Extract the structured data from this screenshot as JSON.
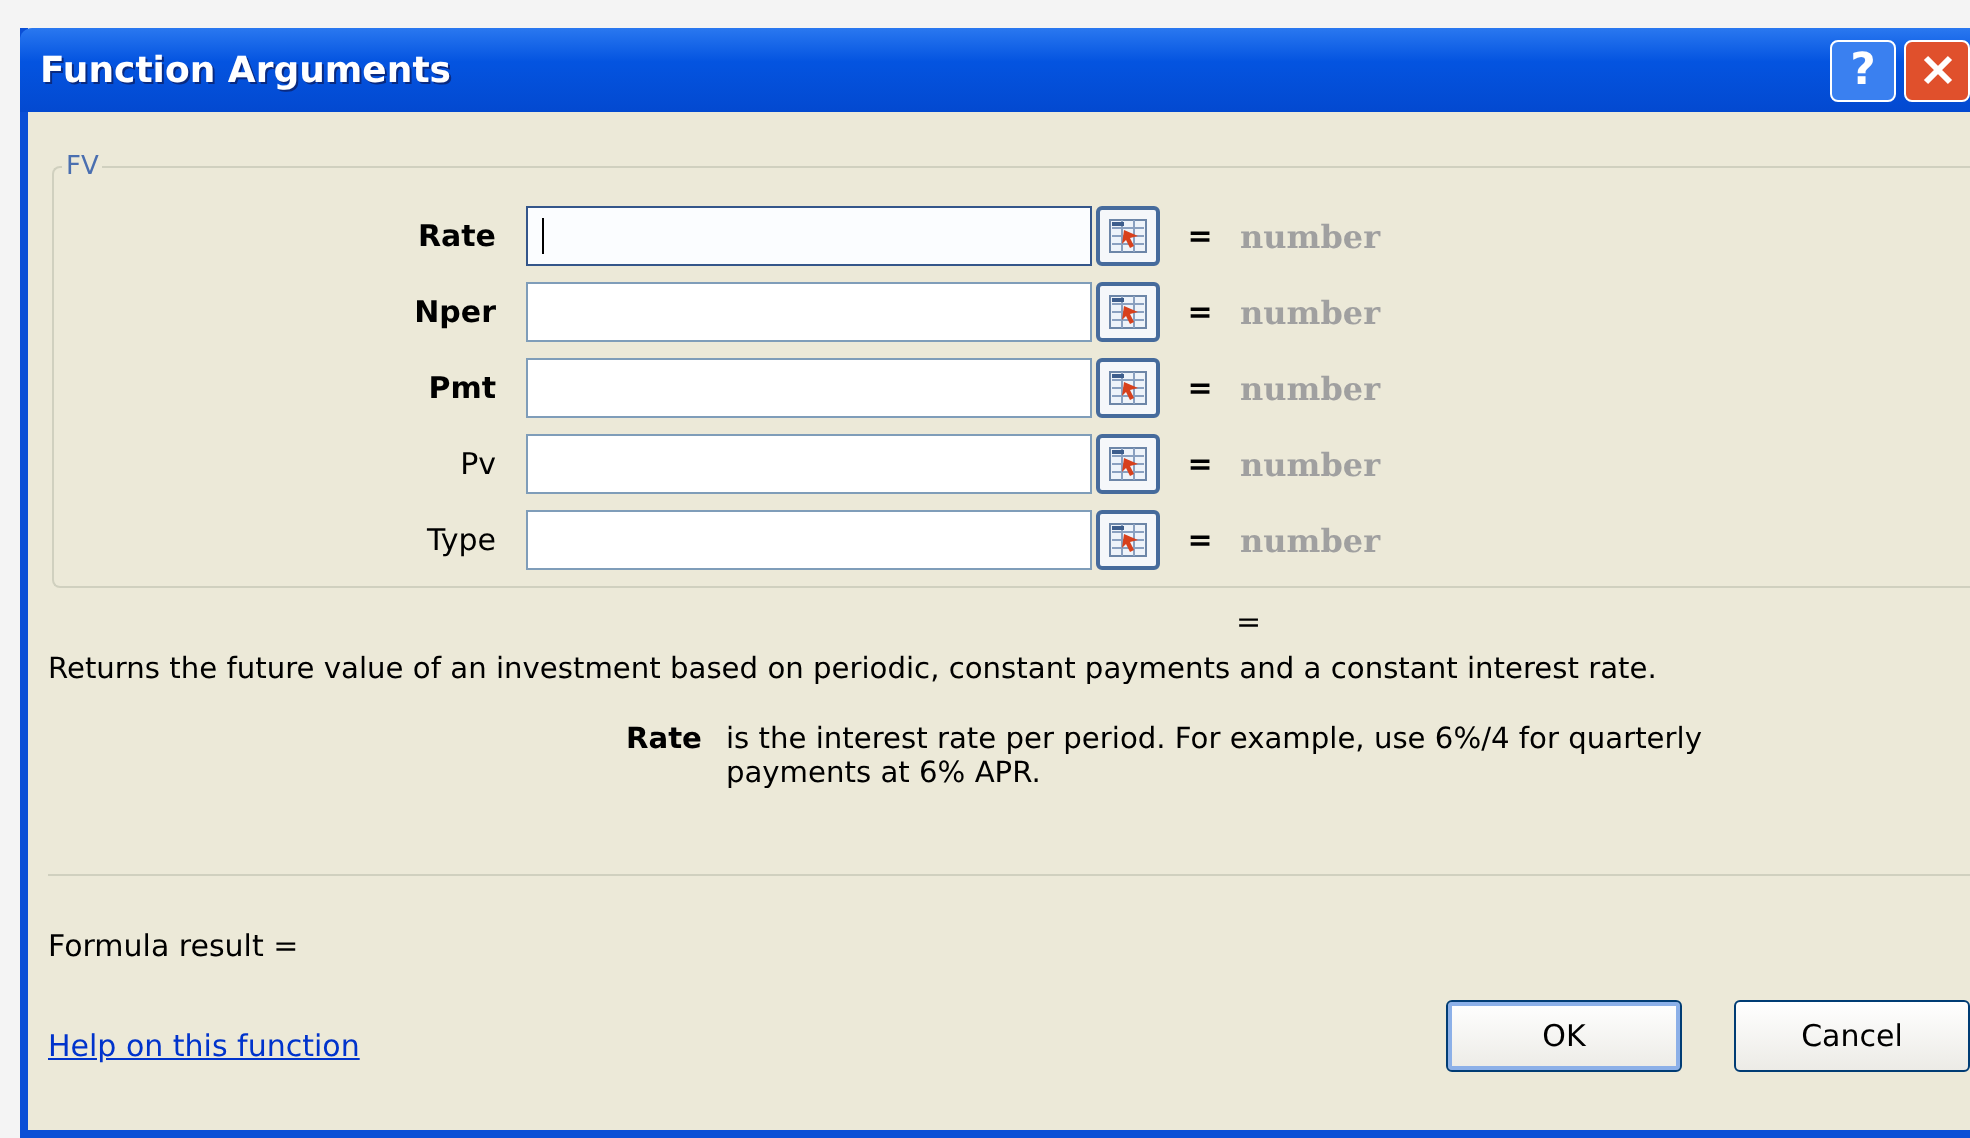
{
  "window": {
    "title": "Function Arguments",
    "help_button": "?"
  },
  "group": {
    "title": "FV",
    "arguments": [
      {
        "label": "Rate",
        "bold": true,
        "focused": true,
        "equals": "=",
        "result": "number"
      },
      {
        "label": "Nper",
        "bold": true,
        "focused": false,
        "equals": "=",
        "result": "number"
      },
      {
        "label": "Pmt",
        "bold": true,
        "focused": false,
        "equals": "=",
        "result": "number"
      },
      {
        "label": "Pv",
        "bold": false,
        "focused": false,
        "equals": "=",
        "result": "number"
      },
      {
        "label": "Type",
        "bold": false,
        "focused": false,
        "equals": "=",
        "result": "number"
      }
    ]
  },
  "function_result": "=",
  "description": "Returns the future value of an investment based on periodic, constant payments and a constant interest rate.",
  "argument_help": {
    "name": "Rate",
    "text": "is the interest rate per period. For example, use 6%/4 for quarterly payments at 6% APR."
  },
  "formula_result": "Formula result =",
  "help_link": "Help on this function",
  "buttons": [
    {
      "label": "OK",
      "default": true
    },
    {
      "label": "Cancel",
      "default": false
    }
  ]
}
